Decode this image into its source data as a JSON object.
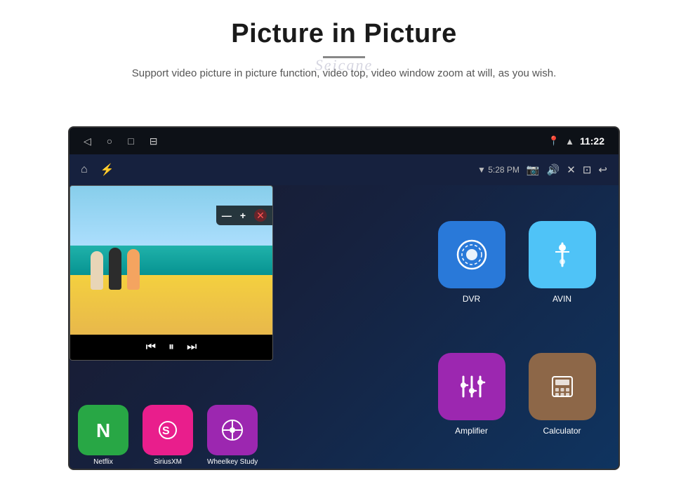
{
  "page": {
    "title": "Picture in Picture",
    "divider": "—",
    "watermark": "Seicane",
    "subtitle": "Support video picture in picture function, video top, video window zoom at will, as you wish."
  },
  "status_bar": {
    "left_icons": [
      "◁",
      "○",
      "□",
      "⊟"
    ],
    "right_signal": "▲▼",
    "wifi": "▼",
    "time": "11:22"
  },
  "toolbar": {
    "home_icon": "⌂",
    "usb_icon": "⚡",
    "wifi_label": "▼ 5:28 PM",
    "camera_icon": "📷",
    "volume_icon": "🔊",
    "close_icon": "✕",
    "window_icon": "⊡",
    "back_icon": "↩"
  },
  "pip": {
    "play_icon": "▶",
    "minus_label": "—",
    "plus_label": "+",
    "close_label": "✕",
    "prev_label": "⏮",
    "play_pause_label": "⏭",
    "next_label": "⏭"
  },
  "right_apps": [
    {
      "id": "dvr",
      "label": "DVR",
      "color": "#2979d9",
      "icon": "📡"
    },
    {
      "id": "avin",
      "label": "AVIN",
      "color": "#4fc3f7",
      "icon": "🔌"
    },
    {
      "id": "amplifier",
      "label": "Amplifier",
      "color": "#9c27b0",
      "icon": "🎛"
    },
    {
      "id": "calculator",
      "label": "Calculator",
      "color": "#8d6748",
      "icon": "🧮"
    }
  ],
  "bottom_apps": [
    {
      "id": "netflix",
      "label": "Netflix",
      "color": "#28a745",
      "icon": "N"
    },
    {
      "id": "siriusxm",
      "label": "SiriusXM",
      "color": "#e91e8c",
      "icon": "S"
    },
    {
      "id": "wheelkey",
      "label": "Wheelkey Study",
      "color": "#9c27b0",
      "icon": "W"
    }
  ]
}
